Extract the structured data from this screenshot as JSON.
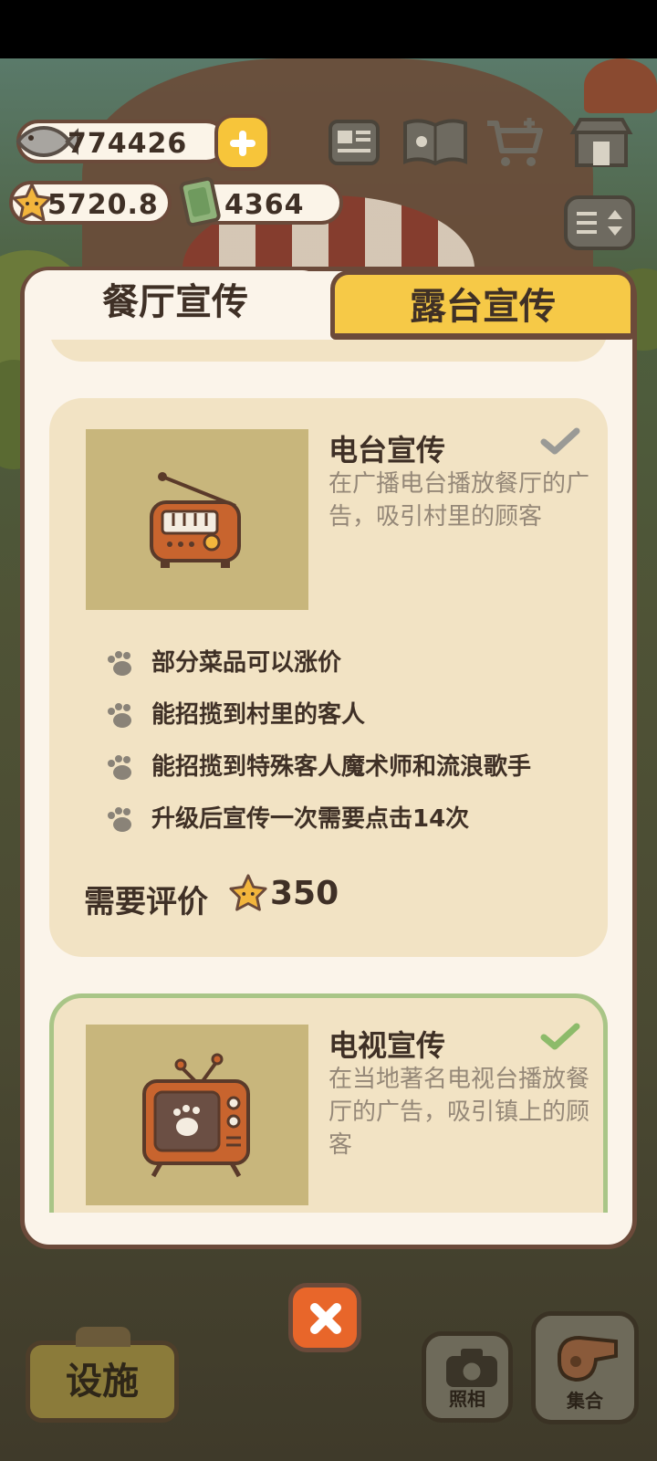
{
  "currency": {
    "fish": "774426",
    "stars": "5720.8",
    "cash": "4364"
  },
  "tabs": {
    "restaurant": "餐厅宣传",
    "terrace": "露台宣传"
  },
  "cards": [
    {
      "title": "电台宣传",
      "desc": "在广播电台播放餐厅的广告，吸引村里的顾客",
      "features": [
        "部分菜品可以涨价",
        "能招揽到村里的客人",
        "能招揽到特殊客人魔术师和流浪歌手",
        "升级后宣传一次需要点击14次"
      ],
      "req_label": "需要评价",
      "req_value": "350",
      "icon": "radio-icon",
      "check_color": "#9a9a96"
    },
    {
      "title": "电视宣传",
      "desc": "在当地著名电视台播放餐厅的广告，吸引镇上的顾客",
      "icon": "tv-icon",
      "check_color": "#8dbb6a"
    }
  ],
  "bottom": {
    "facility": "设施",
    "photo": "照相",
    "gather": "集合"
  }
}
